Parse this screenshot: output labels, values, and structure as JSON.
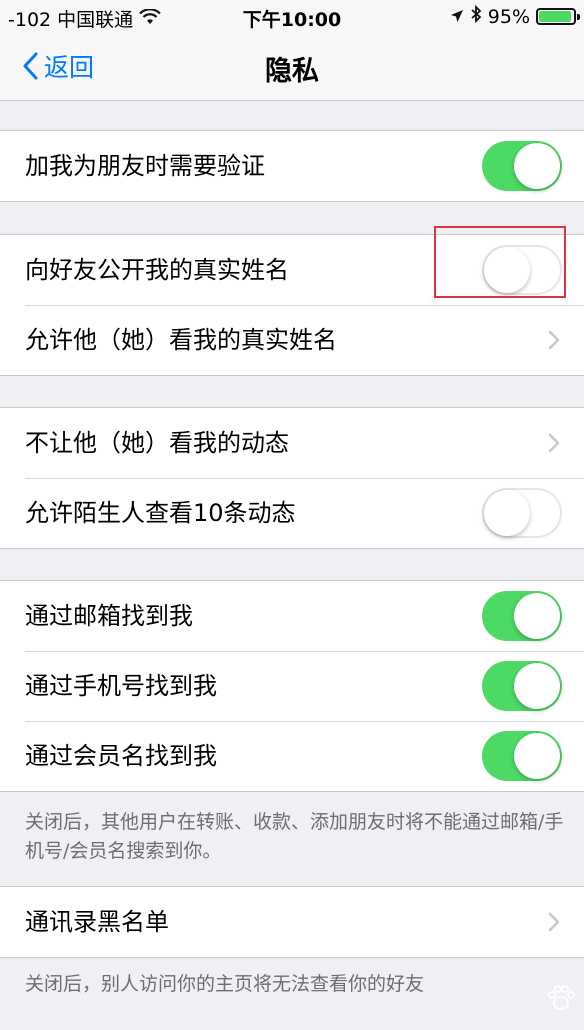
{
  "status_bar": {
    "carrier": "-102 中国联通",
    "time": "下午10:00",
    "battery_percent": "95%",
    "battery_level": 0.95
  },
  "nav": {
    "back_label": "返回",
    "title": "隐私"
  },
  "group1": {
    "items": [
      {
        "label": "加我为朋友时需要验证",
        "toggle": "on"
      }
    ]
  },
  "group2": {
    "items": [
      {
        "label": "向好友公开我的真实姓名",
        "toggle": "off"
      },
      {
        "label": "允许他（她）看我的真实姓名"
      }
    ]
  },
  "group3": {
    "items": [
      {
        "label": "不让他（她）看我的动态"
      },
      {
        "label": "允许陌生人查看10条动态",
        "toggle": "off"
      }
    ]
  },
  "group4": {
    "items": [
      {
        "label": "通过邮箱找到我",
        "toggle": "on"
      },
      {
        "label": "通过手机号找到我",
        "toggle": "on"
      },
      {
        "label": "通过会员名找到我",
        "toggle": "on"
      }
    ],
    "note": "关闭后，其他用户在转账、收款、添加朋友时将不能通过邮箱/手机号/会员名搜索到你。"
  },
  "group5": {
    "items": [
      {
        "label": "通讯录黑名单"
      }
    ],
    "note": "关闭后，别人访问你的主页将无法查看你的好友"
  },
  "colors": {
    "accent": "#007aff",
    "switch_on": "#4cd964",
    "highlight": "#d9363e"
  }
}
